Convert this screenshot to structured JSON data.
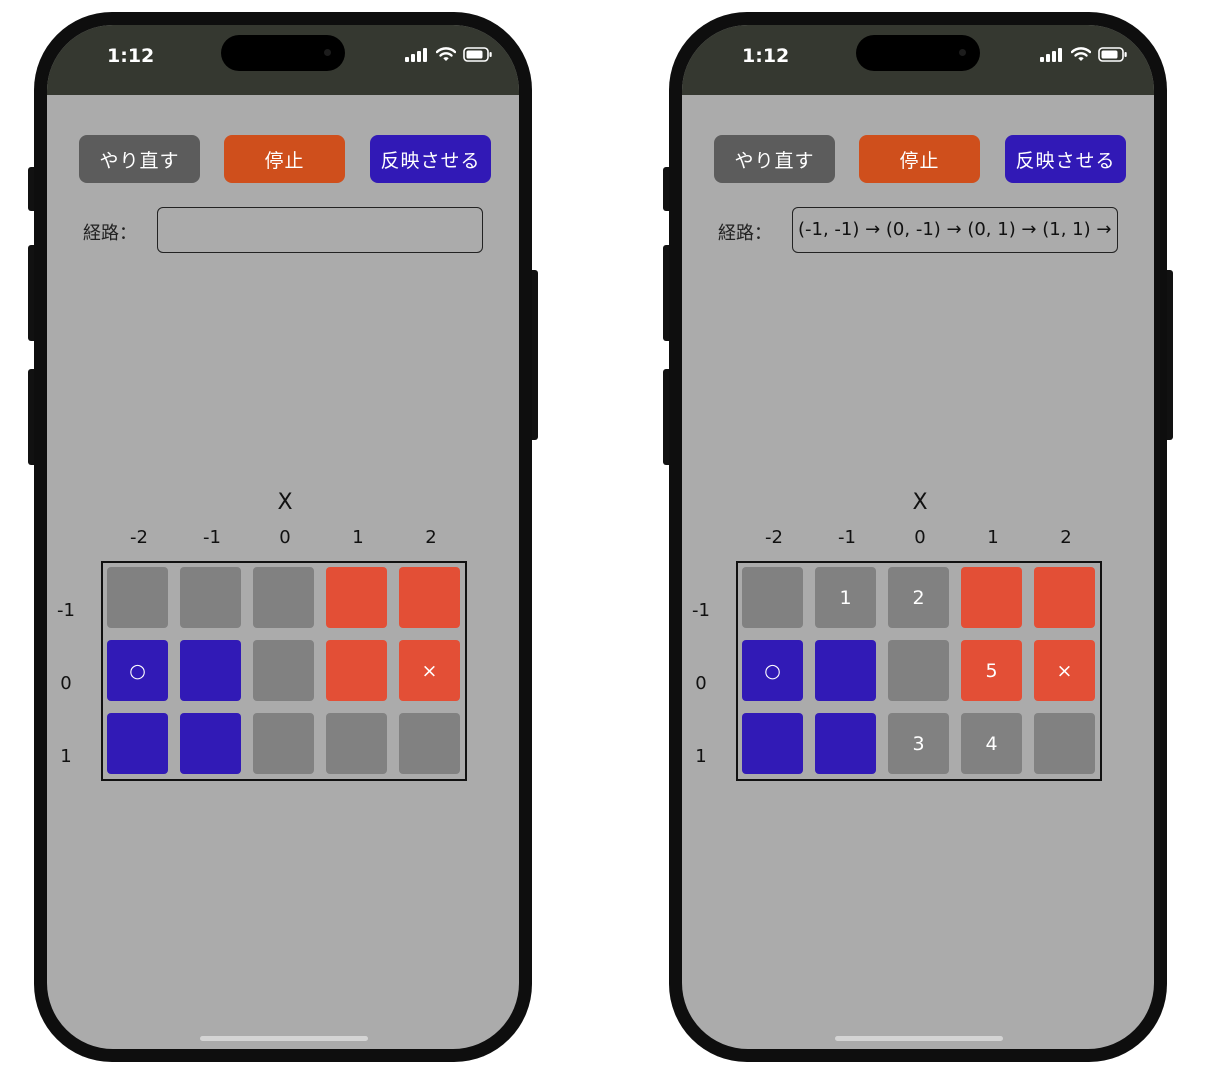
{
  "phones": [
    {
      "status": {
        "time": "1:12"
      },
      "buttons": {
        "reset": "やり直す",
        "stop": "停止",
        "apply": "反映させる"
      },
      "path": {
        "label": "経路：",
        "value": ""
      },
      "axis_x": "X",
      "columns": [
        "-2",
        "-1",
        "0",
        "1",
        "2"
      ],
      "rows": [
        "-1",
        "0",
        "1"
      ],
      "grid": [
        [
          "",
          "",
          "",
          "",
          ""
        ],
        [
          "○",
          "",
          "",
          "",
          "×"
        ],
        [
          "",
          "",
          "",
          "",
          ""
        ]
      ]
    },
    {
      "status": {
        "time": "1:12"
      },
      "buttons": {
        "reset": "やり直す",
        "stop": "停止",
        "apply": "反映させる"
      },
      "path": {
        "label": "経路：",
        "value": "(-1, -1) → (0, -1) → (0, 1) → (1, 1) →"
      },
      "axis_x": "X",
      "columns": [
        "-2",
        "-1",
        "0",
        "1",
        "2"
      ],
      "rows": [
        "-1",
        "0",
        "1"
      ],
      "grid": [
        [
          "",
          "1",
          "2",
          "",
          ""
        ],
        [
          "○",
          "",
          "",
          "5",
          "×"
        ],
        [
          "",
          "",
          "3",
          "4",
          ""
        ]
      ]
    }
  ],
  "grid_colors": [
    [
      "gray",
      "gray",
      "gray",
      "red",
      "red"
    ],
    [
      "blue",
      "blue",
      "gray",
      "red",
      "red"
    ],
    [
      "blue",
      "blue",
      "gray",
      "gray",
      "gray"
    ]
  ],
  "colors": {
    "reset_button": "#5c5c5c",
    "stop_button": "#cf4f1c",
    "apply_button": "#3119b6",
    "cell_gray": "#818181",
    "cell_blue": "#311ab6",
    "cell_red": "#e34f36",
    "screen_bg": "#ababab",
    "status_bar": "#353830"
  },
  "icons": {
    "signal": "cellular-signal-icon",
    "wifi": "wifi-icon",
    "battery": "battery-icon"
  }
}
